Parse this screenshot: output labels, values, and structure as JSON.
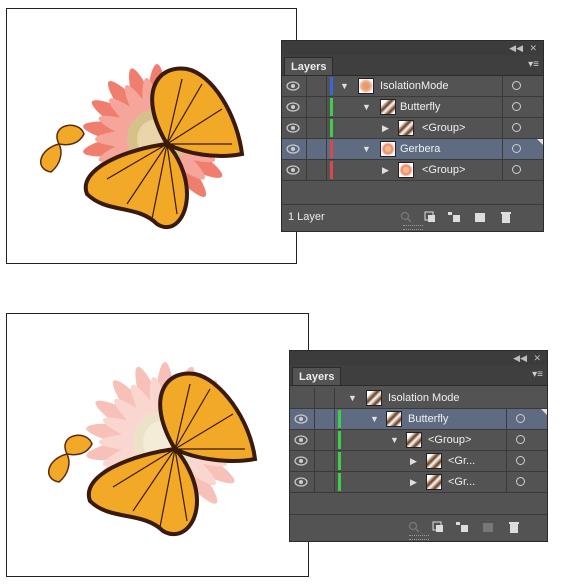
{
  "top_panel": {
    "tab_label": "Layers",
    "collapse_icon": "double-chevron-icon",
    "close_icon": "close-icon",
    "menu_icon": "panel-menu-icon",
    "rows": [
      {
        "name": "IsolationMode",
        "expanded": true,
        "selected": false,
        "color": "#3b66d6",
        "thumb": "flower-butterfly"
      },
      {
        "name": "Butterfly",
        "expanded": true,
        "selected": false,
        "color": "#3fce4a",
        "thumb": "butterfly"
      },
      {
        "name": "<Group>",
        "expanded": false,
        "selected": false,
        "color": "#3fce4a",
        "thumb": "butterfly"
      },
      {
        "name": "Gerbera",
        "expanded": true,
        "selected": true,
        "color": "#d84a4a",
        "thumb": "flower"
      },
      {
        "name": "<Group>",
        "expanded": false,
        "selected": false,
        "color": "#d84a4a",
        "thumb": "flower"
      }
    ],
    "footer_count": "1 Layer"
  },
  "bottom_panel": {
    "tab_label": "Layers",
    "collapse_icon": "double-chevron-icon",
    "close_icon": "close-icon",
    "menu_icon": "panel-menu-icon",
    "rows": [
      {
        "name": "Isolation Mode",
        "expanded": true,
        "selected": false,
        "color": "",
        "thumb": "flower-butterfly"
      },
      {
        "name": "Butterfly",
        "expanded": true,
        "selected": true,
        "color": "#3fce4a",
        "thumb": "butterfly"
      },
      {
        "name": "<Group>",
        "expanded": true,
        "selected": false,
        "color": "#3fce4a",
        "thumb": "butterfly"
      },
      {
        "name": "<Gr...",
        "expanded": false,
        "selected": false,
        "color": "#3fce4a",
        "thumb": "butterfly"
      },
      {
        "name": "<Gr...",
        "expanded": false,
        "selected": false,
        "color": "#3fce4a",
        "thumb": "butterfly"
      }
    ],
    "footer_count": ""
  },
  "colors": {
    "panel_bg": "#535353",
    "selected_row": "#5e6b80",
    "petal_top": "#f08070",
    "petal_bottom": "#f7bcbc",
    "wing": "#f2a928"
  }
}
